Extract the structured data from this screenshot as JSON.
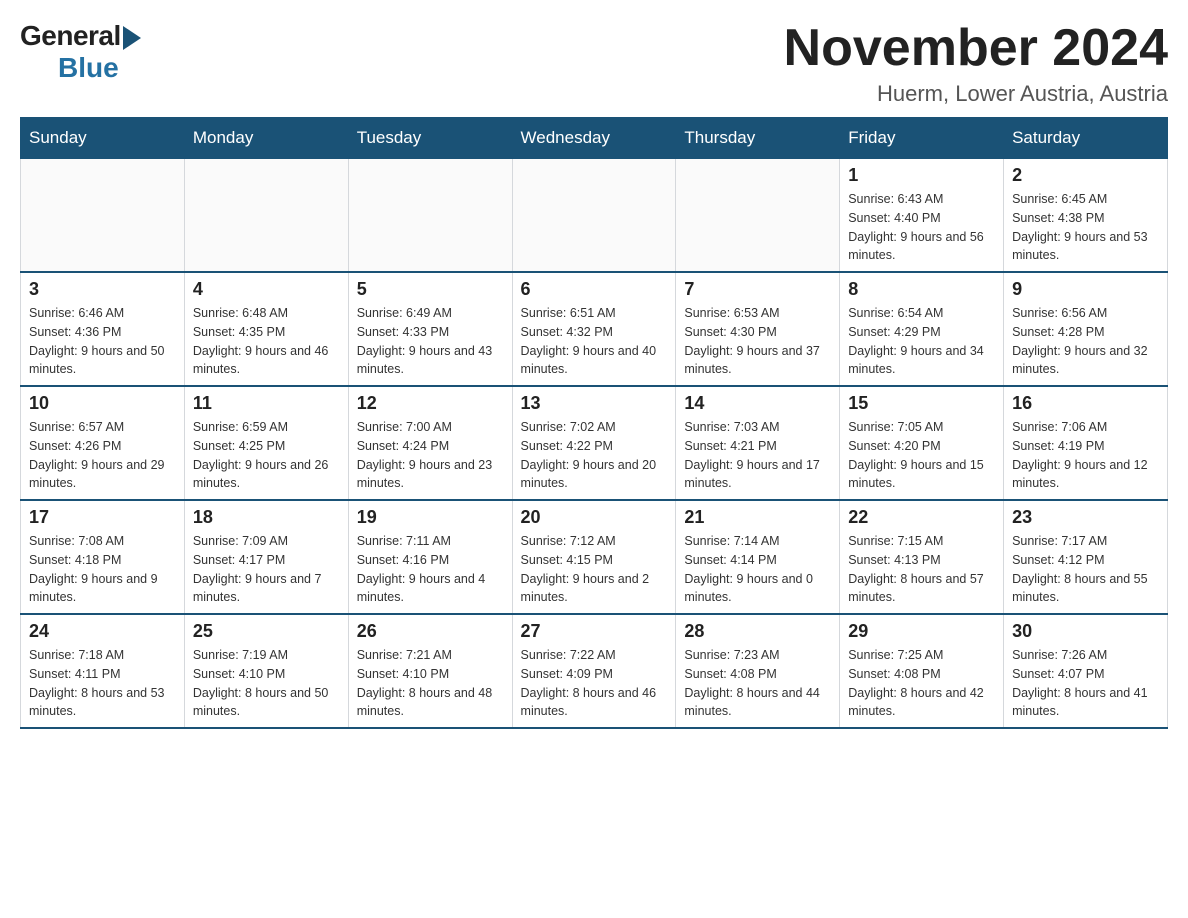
{
  "logo": {
    "general": "General",
    "blue": "Blue"
  },
  "title": "November 2024",
  "subtitle": "Huerm, Lower Austria, Austria",
  "days": [
    "Sunday",
    "Monday",
    "Tuesday",
    "Wednesday",
    "Thursday",
    "Friday",
    "Saturday"
  ],
  "weeks": [
    [
      {
        "day": "",
        "info": ""
      },
      {
        "day": "",
        "info": ""
      },
      {
        "day": "",
        "info": ""
      },
      {
        "day": "",
        "info": ""
      },
      {
        "day": "",
        "info": ""
      },
      {
        "day": "1",
        "info": "Sunrise: 6:43 AM\nSunset: 4:40 PM\nDaylight: 9 hours and 56 minutes."
      },
      {
        "day": "2",
        "info": "Sunrise: 6:45 AM\nSunset: 4:38 PM\nDaylight: 9 hours and 53 minutes."
      }
    ],
    [
      {
        "day": "3",
        "info": "Sunrise: 6:46 AM\nSunset: 4:36 PM\nDaylight: 9 hours and 50 minutes."
      },
      {
        "day": "4",
        "info": "Sunrise: 6:48 AM\nSunset: 4:35 PM\nDaylight: 9 hours and 46 minutes."
      },
      {
        "day": "5",
        "info": "Sunrise: 6:49 AM\nSunset: 4:33 PM\nDaylight: 9 hours and 43 minutes."
      },
      {
        "day": "6",
        "info": "Sunrise: 6:51 AM\nSunset: 4:32 PM\nDaylight: 9 hours and 40 minutes."
      },
      {
        "day": "7",
        "info": "Sunrise: 6:53 AM\nSunset: 4:30 PM\nDaylight: 9 hours and 37 minutes."
      },
      {
        "day": "8",
        "info": "Sunrise: 6:54 AM\nSunset: 4:29 PM\nDaylight: 9 hours and 34 minutes."
      },
      {
        "day": "9",
        "info": "Sunrise: 6:56 AM\nSunset: 4:28 PM\nDaylight: 9 hours and 32 minutes."
      }
    ],
    [
      {
        "day": "10",
        "info": "Sunrise: 6:57 AM\nSunset: 4:26 PM\nDaylight: 9 hours and 29 minutes."
      },
      {
        "day": "11",
        "info": "Sunrise: 6:59 AM\nSunset: 4:25 PM\nDaylight: 9 hours and 26 minutes."
      },
      {
        "day": "12",
        "info": "Sunrise: 7:00 AM\nSunset: 4:24 PM\nDaylight: 9 hours and 23 minutes."
      },
      {
        "day": "13",
        "info": "Sunrise: 7:02 AM\nSunset: 4:22 PM\nDaylight: 9 hours and 20 minutes."
      },
      {
        "day": "14",
        "info": "Sunrise: 7:03 AM\nSunset: 4:21 PM\nDaylight: 9 hours and 17 minutes."
      },
      {
        "day": "15",
        "info": "Sunrise: 7:05 AM\nSunset: 4:20 PM\nDaylight: 9 hours and 15 minutes."
      },
      {
        "day": "16",
        "info": "Sunrise: 7:06 AM\nSunset: 4:19 PM\nDaylight: 9 hours and 12 minutes."
      }
    ],
    [
      {
        "day": "17",
        "info": "Sunrise: 7:08 AM\nSunset: 4:18 PM\nDaylight: 9 hours and 9 minutes."
      },
      {
        "day": "18",
        "info": "Sunrise: 7:09 AM\nSunset: 4:17 PM\nDaylight: 9 hours and 7 minutes."
      },
      {
        "day": "19",
        "info": "Sunrise: 7:11 AM\nSunset: 4:16 PM\nDaylight: 9 hours and 4 minutes."
      },
      {
        "day": "20",
        "info": "Sunrise: 7:12 AM\nSunset: 4:15 PM\nDaylight: 9 hours and 2 minutes."
      },
      {
        "day": "21",
        "info": "Sunrise: 7:14 AM\nSunset: 4:14 PM\nDaylight: 9 hours and 0 minutes."
      },
      {
        "day": "22",
        "info": "Sunrise: 7:15 AM\nSunset: 4:13 PM\nDaylight: 8 hours and 57 minutes."
      },
      {
        "day": "23",
        "info": "Sunrise: 7:17 AM\nSunset: 4:12 PM\nDaylight: 8 hours and 55 minutes."
      }
    ],
    [
      {
        "day": "24",
        "info": "Sunrise: 7:18 AM\nSunset: 4:11 PM\nDaylight: 8 hours and 53 minutes."
      },
      {
        "day": "25",
        "info": "Sunrise: 7:19 AM\nSunset: 4:10 PM\nDaylight: 8 hours and 50 minutes."
      },
      {
        "day": "26",
        "info": "Sunrise: 7:21 AM\nSunset: 4:10 PM\nDaylight: 8 hours and 48 minutes."
      },
      {
        "day": "27",
        "info": "Sunrise: 7:22 AM\nSunset: 4:09 PM\nDaylight: 8 hours and 46 minutes."
      },
      {
        "day": "28",
        "info": "Sunrise: 7:23 AM\nSunset: 4:08 PM\nDaylight: 8 hours and 44 minutes."
      },
      {
        "day": "29",
        "info": "Sunrise: 7:25 AM\nSunset: 4:08 PM\nDaylight: 8 hours and 42 minutes."
      },
      {
        "day": "30",
        "info": "Sunrise: 7:26 AM\nSunset: 4:07 PM\nDaylight: 8 hours and 41 minutes."
      }
    ]
  ]
}
